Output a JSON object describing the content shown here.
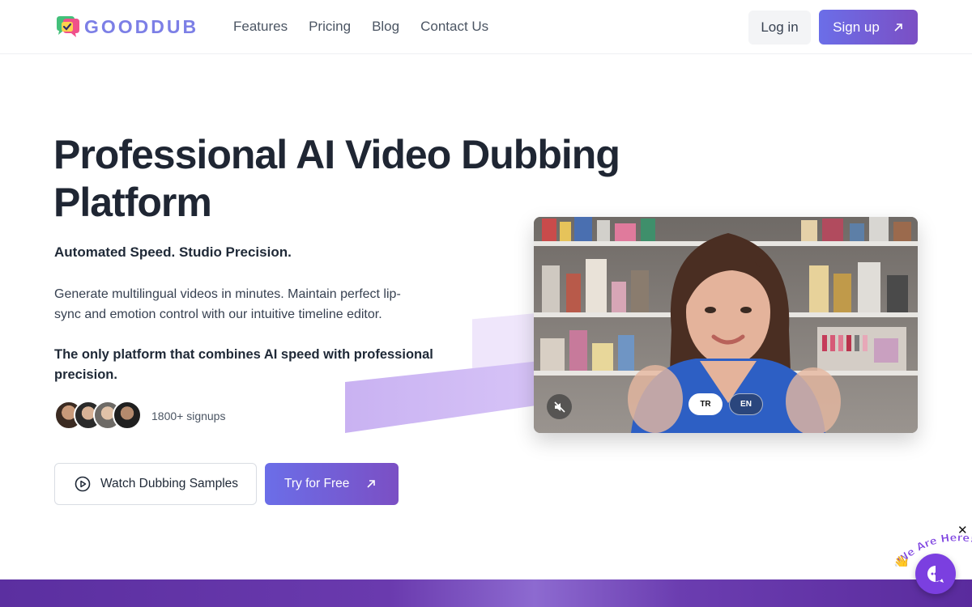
{
  "header": {
    "logo_text": "GOODDUB",
    "nav": [
      "Features",
      "Pricing",
      "Blog",
      "Contact Us"
    ],
    "login_label": "Log in",
    "signup_label": "Sign up"
  },
  "hero": {
    "title": "Professional AI Video Dubbing Platform",
    "tagline": "Automated Speed. Studio Precision.",
    "description": "Generate multilingual videos in minutes. Maintain perfect lip-sync and emotion control with our intuitive timeline editor.",
    "emphasis": "The only platform that combines AI speed with professional precision.",
    "signups": "1800+ signups",
    "watch_label": "Watch Dubbing Samples",
    "try_label": "Try for Free"
  },
  "video": {
    "languages": [
      "TR",
      "EN"
    ],
    "selected_language": "TR"
  },
  "chat": {
    "label": "We Are Here!"
  },
  "colors": {
    "accent_start": "#6b6ee8",
    "accent_end": "#7b4fc4",
    "chat": "#7b3fe0"
  }
}
